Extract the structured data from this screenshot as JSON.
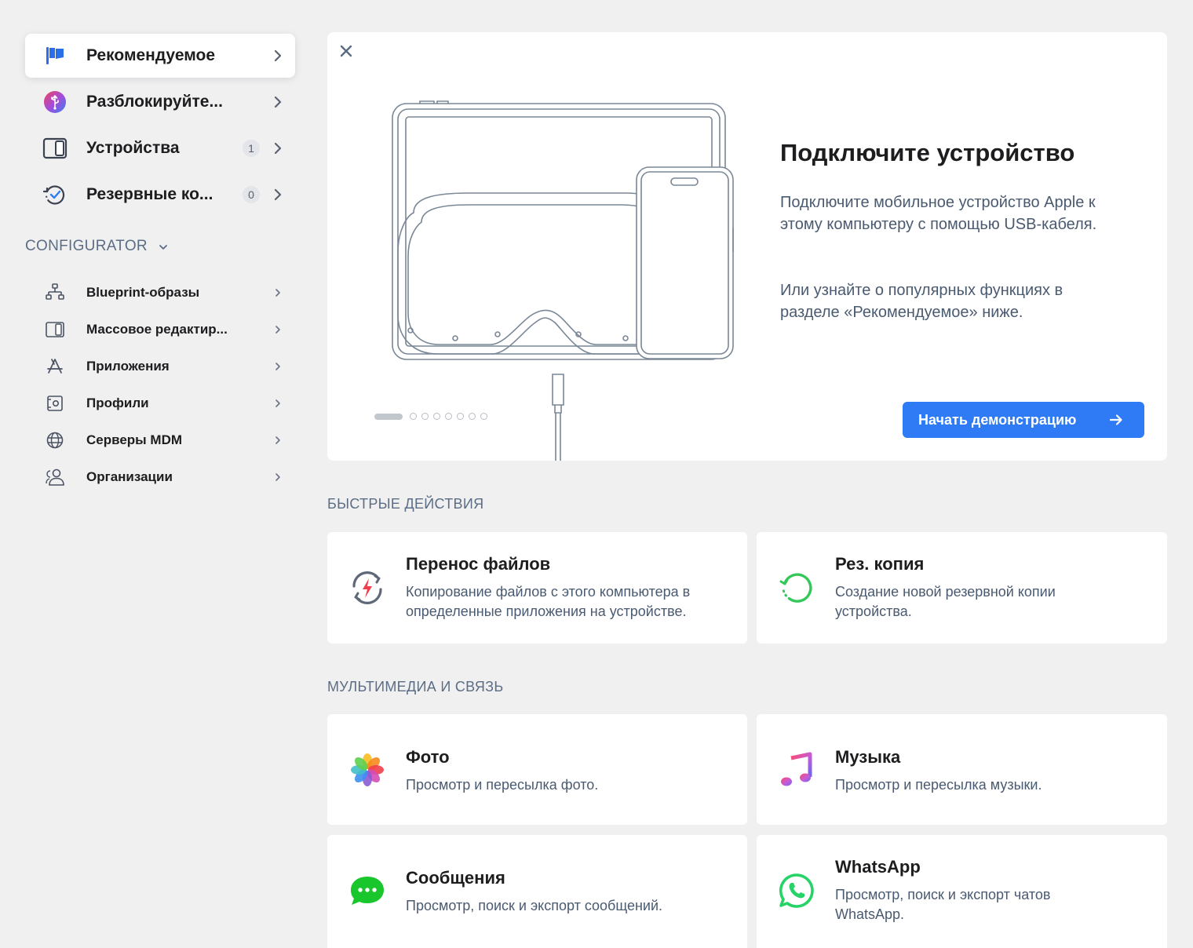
{
  "sidebar": {
    "items": [
      {
        "label": "Рекомендуемое",
        "icon": "flag-icon",
        "selected": true
      },
      {
        "label": "Разблокируйте...",
        "icon": "unlock-usb-icon"
      },
      {
        "label": "Устройства",
        "icon": "devices-icon",
        "badge": "1"
      },
      {
        "label": "Резервные ко...",
        "icon": "backup-icon",
        "badge": "0"
      }
    ],
    "section_title": "CONFIGURATOR",
    "sub_items": [
      {
        "label": "Blueprint-образы",
        "icon": "blueprint-icon"
      },
      {
        "label": "Массовое редактир...",
        "icon": "mass-edit-icon"
      },
      {
        "label": "Приложения",
        "icon": "app-store-icon"
      },
      {
        "label": "Профили",
        "icon": "profile-gear-icon"
      },
      {
        "label": "Серверы MDM",
        "icon": "globe-icon"
      },
      {
        "label": "Организации",
        "icon": "people-icon"
      }
    ]
  },
  "hero": {
    "title": "Подключите устройство",
    "text1": "Подключите мобильное устройство Apple к этому компьютеру с помощью USB-кабеля.",
    "text2": "Или узнайте о популярных функциях в разделе «Рекомендуемое» ниже.",
    "button_label": "Начать демонстрацию",
    "page_count": 8,
    "current_page": 1
  },
  "quick_actions": {
    "title": "БЫСТРЫЕ ДЕЙСТВИЯ",
    "cards": [
      {
        "title": "Перенос файлов",
        "desc": "Копирование файлов с этого компьютера в определенные приложения на устройстве.",
        "icon": "file-transfer-icon"
      },
      {
        "title": "Рез. копия",
        "desc": "Создание новой резервной копии устройства.",
        "icon": "backup-circle-icon"
      }
    ]
  },
  "media": {
    "title": "МУЛЬТИМЕДИА И СВЯЗЬ",
    "cards": [
      {
        "title": "Фото",
        "desc": "Просмотр и пересылка фото.",
        "icon": "photos-icon"
      },
      {
        "title": "Музыка",
        "desc": "Просмотр и пересылка музыки.",
        "icon": "music-icon"
      },
      {
        "title": "Сообщения",
        "desc": "Просмотр, поиск и экспорт сообщений.",
        "icon": "messages-icon"
      },
      {
        "title": "WhatsApp",
        "desc": "Просмотр, поиск и экспорт чатов WhatsApp.",
        "icon": "whatsapp-icon"
      }
    ]
  },
  "colors": {
    "accent": "#2f7bf5",
    "section_text": "#5b6d85",
    "body_text": "#4a5a70"
  }
}
